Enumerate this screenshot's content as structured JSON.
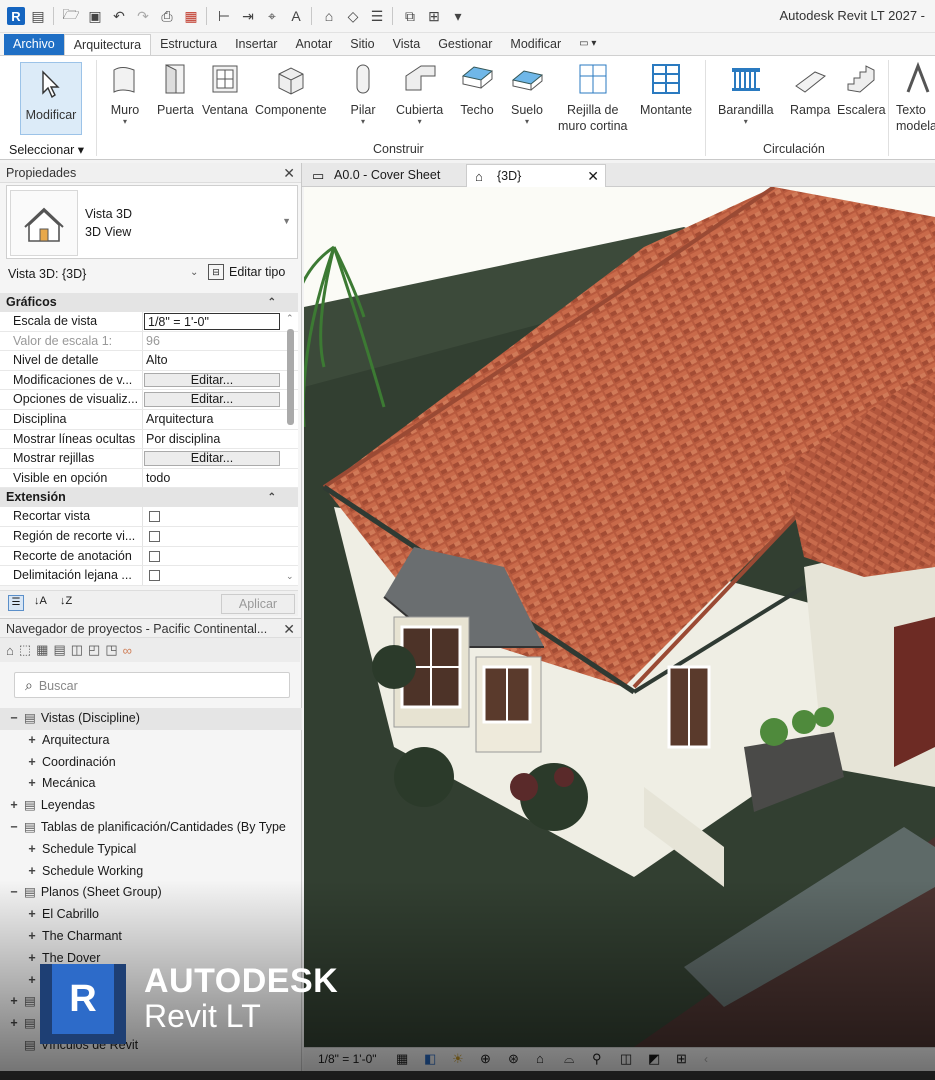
{
  "app_title": "Autodesk Revit LT 2027 -",
  "qat_logo": "R",
  "tabs": [
    "Archivo",
    "Arquitectura",
    "Estructura",
    "Insertar",
    "Anotar",
    "Sitio",
    "Vista",
    "Gestionar",
    "Modificar"
  ],
  "ribbon": {
    "modify": "Modificar",
    "select": "Seleccionar",
    "build_buttons": [
      {
        "label": "Muro",
        "sub": "▾"
      },
      {
        "label": "Puerta",
        "sub": ""
      },
      {
        "label": "Ventana",
        "sub": ""
      },
      {
        "label": "Componente",
        "sub": ""
      },
      {
        "label": "Pilar",
        "sub": "▾"
      },
      {
        "label": "Cubierta",
        "sub": "▾"
      },
      {
        "label": "Techo",
        "sub": ""
      },
      {
        "label": "Suelo",
        "sub": "▾"
      },
      {
        "label": "Rejilla de",
        "sub": "muro cortina"
      },
      {
        "label": "Montante",
        "sub": ""
      }
    ],
    "build_label": "Construir",
    "circ_buttons": [
      {
        "label": "Barandilla",
        "sub": "▾"
      },
      {
        "label": "Rampa",
        "sub": ""
      },
      {
        "label": "Escalera",
        "sub": ""
      }
    ],
    "circ_label": "Circulación",
    "text_button": {
      "label": "Texto",
      "sub": "modelado"
    }
  },
  "properties": {
    "title": "Propiedades",
    "type_line1": "Vista 3D",
    "type_line2": "3D View",
    "view_selector": "Vista 3D: {3D}",
    "edit_type": "Editar tipo",
    "groups": [
      {
        "name": "Gráficos",
        "rows": [
          {
            "k": "Escala de vista",
            "v": "1/8\" = 1'-0\"",
            "kind": "input"
          },
          {
            "k": "Valor de escala    1:",
            "v": "96",
            "kind": "dim"
          },
          {
            "k": "Nivel de detalle",
            "v": "Alto",
            "kind": "text"
          },
          {
            "k": "Modificaciones de v...",
            "v": "Editar...",
            "kind": "button"
          },
          {
            "k": "Opciones de visualiz...",
            "v": "Editar...",
            "kind": "button"
          },
          {
            "k": "Disciplina",
            "v": "Arquitectura",
            "kind": "text"
          },
          {
            "k": "Mostrar líneas ocultas",
            "v": "Por disciplina",
            "kind": "text"
          },
          {
            "k": "Mostrar rejillas",
            "v": "Editar...",
            "kind": "button"
          },
          {
            "k": "Visible en opción",
            "v": "todo",
            "kind": "text"
          }
        ]
      },
      {
        "name": "Extensión",
        "rows": [
          {
            "k": "Recortar vista",
            "v": "",
            "kind": "check"
          },
          {
            "k": "Región de recorte vi...",
            "v": "",
            "kind": "check"
          },
          {
            "k": "Recorte de anotación",
            "v": "",
            "kind": "check"
          },
          {
            "k": "Delimitación lejana ...",
            "v": "",
            "kind": "check"
          }
        ]
      }
    ],
    "apply": "Aplicar"
  },
  "browser": {
    "title": "Navegador de proyectos - Pacific Continental...",
    "search_placeholder": "Buscar",
    "items": [
      {
        "t": "Vistas (Discipline)",
        "g": "−",
        "lvl": 0,
        "sel": true
      },
      {
        "t": "Arquitectura",
        "g": "+",
        "lvl": 1
      },
      {
        "t": "Coordinación",
        "g": "+",
        "lvl": 1
      },
      {
        "t": "Mecánica",
        "g": "+",
        "lvl": 1
      },
      {
        "t": "Leyendas",
        "g": "+",
        "lvl": 0
      },
      {
        "t": "Tablas de planificación/Cantidades (By Type",
        "g": "−",
        "lvl": 0
      },
      {
        "t": "Schedule Typical",
        "g": "+",
        "lvl": 1
      },
      {
        "t": "Schedule Working",
        "g": "+",
        "lvl": 1
      },
      {
        "t": "Planos (Sheet Group)",
        "g": "−",
        "lvl": 0
      },
      {
        "t": "El Cabrillo",
        "g": "+",
        "lvl": 1
      },
      {
        "t": "The Charmant",
        "g": "+",
        "lvl": 1
      },
      {
        "t": "The Dover",
        "g": "+",
        "lvl": 1
      },
      {
        "t": "",
        "g": "+",
        "lvl": 1
      },
      {
        "t": "",
        "g": "+",
        "lvl": 0
      },
      {
        "t": "",
        "g": "+",
        "lvl": 0
      },
      {
        "t": "Vínculos de Revit",
        "g": "",
        "lvl": 0
      }
    ]
  },
  "view_tabs": [
    {
      "label": "A0.0 - Cover Sheet",
      "active": false
    },
    {
      "label": "{3D}",
      "active": true
    }
  ],
  "view_scale": "1/8\" = 1'-0\"",
  "brand": {
    "title": "AUTODESK",
    "subtitle": "Revit LT",
    "logo": "R"
  }
}
